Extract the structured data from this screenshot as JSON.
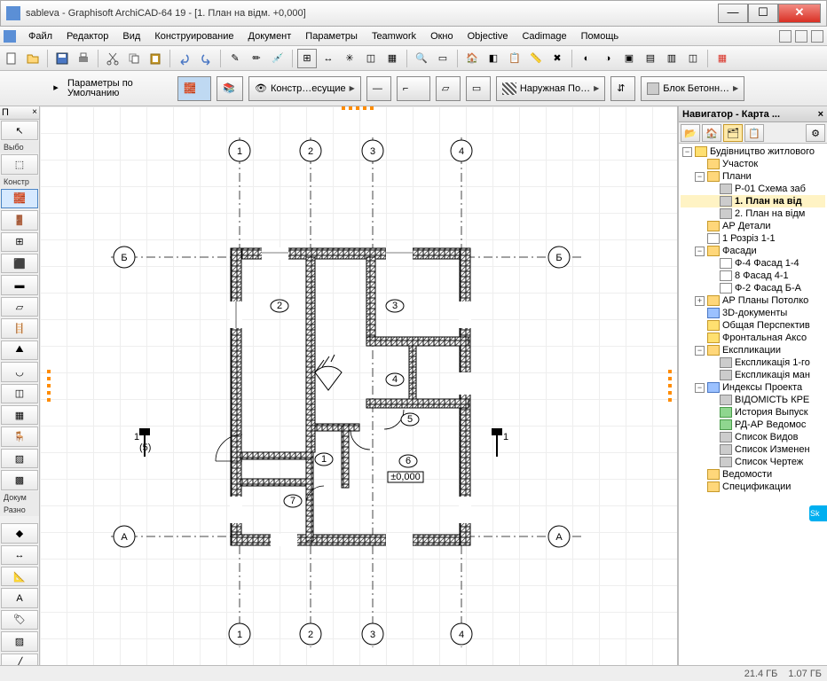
{
  "title": "sableva - Graphisoft ArchiCAD-64 19 - [1. План на відм. +0,000]",
  "menus": [
    "Файл",
    "Редактор",
    "Вид",
    "Конструирование",
    "Документ",
    "Параметры",
    "Teamwork",
    "Окно",
    "Objective",
    "Cadimage",
    "Помощь"
  ],
  "info": {
    "default_label_1": "Параметры по",
    "default_label_2": "Умолчанию",
    "layer_btn": "Констр…есущие",
    "wall_btn": "Наружная По…",
    "mat_btn": "Блок Бетонн…"
  },
  "left_panel": {
    "head1": "П",
    "sel_label": "Выбо",
    "constr_label": "Констр",
    "doc_label": "Докум",
    "razn_label": "Разно"
  },
  "plan": {
    "top_axes": [
      "1",
      "2",
      "3",
      "4"
    ],
    "bottom_axes": [
      "1",
      "2",
      "3",
      "4"
    ],
    "side_axes": [
      "Б",
      "А"
    ],
    "rooms": [
      "2",
      "3",
      "4",
      "5",
      "1",
      "6",
      "7"
    ],
    "level_mark": "±0,000",
    "section_left": "1",
    "section_left_sub": "(5)",
    "section_right": "1"
  },
  "nav": {
    "title": "Навигатор - Карта ...",
    "items": [
      {
        "indent": 0,
        "toggle": "−",
        "icon": "yellow",
        "text": "Будівництво житлового"
      },
      {
        "indent": 1,
        "toggle": "",
        "icon": "folder",
        "text": "Участок"
      },
      {
        "indent": 1,
        "toggle": "−",
        "icon": "folder",
        "text": "Плани"
      },
      {
        "indent": 2,
        "toggle": "",
        "icon": "gray",
        "text": "Р-01 Схема заб"
      },
      {
        "indent": 2,
        "toggle": "",
        "icon": "gray",
        "text": "1. План на від",
        "selected": true
      },
      {
        "indent": 2,
        "toggle": "",
        "icon": "gray",
        "text": "2. План на відм"
      },
      {
        "indent": 1,
        "toggle": "",
        "icon": "folder",
        "text": "АР Детали"
      },
      {
        "indent": 1,
        "toggle": "",
        "icon": "house",
        "text": "1 Розріз 1-1"
      },
      {
        "indent": 1,
        "toggle": "−",
        "icon": "folder",
        "text": "Фасади"
      },
      {
        "indent": 2,
        "toggle": "",
        "icon": "house",
        "text": "Ф-4 Фасад 1-4"
      },
      {
        "indent": 2,
        "toggle": "",
        "icon": "house",
        "text": "8 Фасад 4-1"
      },
      {
        "indent": 2,
        "toggle": "",
        "icon": "house",
        "text": "Ф-2 Фасад Б-А"
      },
      {
        "indent": 1,
        "toggle": "+",
        "icon": "folder",
        "text": "АР Планы Потолко"
      },
      {
        "indent": 1,
        "toggle": "",
        "icon": "blue",
        "text": "3D-документы"
      },
      {
        "indent": 1,
        "toggle": "",
        "icon": "yellow",
        "text": "Общая Перспектив"
      },
      {
        "indent": 1,
        "toggle": "",
        "icon": "yellow",
        "text": "Фронтальная Аксо"
      },
      {
        "indent": 1,
        "toggle": "−",
        "icon": "folder",
        "text": "Експликации"
      },
      {
        "indent": 2,
        "toggle": "",
        "icon": "gray",
        "text": "Експликація 1-го"
      },
      {
        "indent": 2,
        "toggle": "",
        "icon": "gray",
        "text": "Експликація ман"
      },
      {
        "indent": 1,
        "toggle": "−",
        "icon": "blue",
        "text": "Индексы Проекта"
      },
      {
        "indent": 2,
        "toggle": "",
        "icon": "gray",
        "text": "ВІДОМІСТЬ КРЕ"
      },
      {
        "indent": 2,
        "toggle": "",
        "icon": "green",
        "text": "История Выпуск"
      },
      {
        "indent": 2,
        "toggle": "",
        "icon": "green",
        "text": "РД-АР Ведомос"
      },
      {
        "indent": 2,
        "toggle": "",
        "icon": "gray",
        "text": "Список Видов"
      },
      {
        "indent": 2,
        "toggle": "",
        "icon": "gray",
        "text": "Список Изменен"
      },
      {
        "indent": 2,
        "toggle": "",
        "icon": "gray",
        "text": "Список Чертеж"
      },
      {
        "indent": 1,
        "toggle": "",
        "icon": "folder",
        "text": "Ведомости"
      },
      {
        "indent": 1,
        "toggle": "",
        "icon": "folder",
        "text": "Спецификации"
      }
    ]
  },
  "status": {
    "mem1": "21.4 ГБ",
    "mem2": "1.07 ГБ"
  }
}
